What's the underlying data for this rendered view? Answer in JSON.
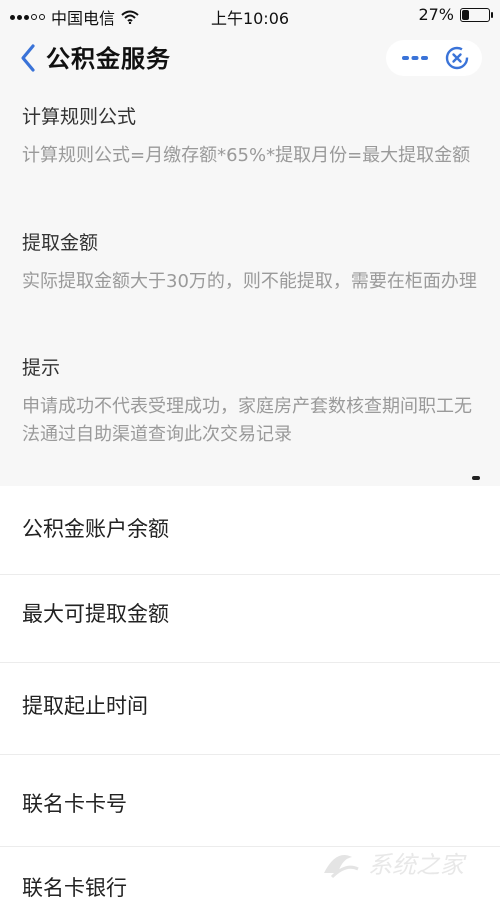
{
  "status_bar": {
    "carrier": "中国电信",
    "time": "上午10:06",
    "battery_text": "27%",
    "battery_level": 0.27
  },
  "nav": {
    "title": "公积金服务",
    "back_icon": "chevron-left-icon",
    "more_icon": "more-dots-icon",
    "close_icon": "close-circle-icon",
    "accent_color": "#3a73d8"
  },
  "info": [
    {
      "title": "计算规则公式",
      "text": "计算规则公式=月缴存额*65%*提取月份=最大提取金额"
    },
    {
      "title": "提取金额",
      "text": "实际提取金额大于30万的，则不能提取，需要在柜面办理"
    },
    {
      "title": "提示",
      "text": "申请成功不代表受理成功，家庭房产套数核查期间职工无法通过自助渠道查询此次交易记录"
    }
  ],
  "list": [
    {
      "label": "公积金账户余额"
    },
    {
      "label": "最大可提取金额"
    },
    {
      "label": "提取起止时间"
    },
    {
      "label": "联名卡卡号"
    },
    {
      "label": "联名卡银行"
    }
  ],
  "watermark": {
    "text": "系统之家"
  }
}
